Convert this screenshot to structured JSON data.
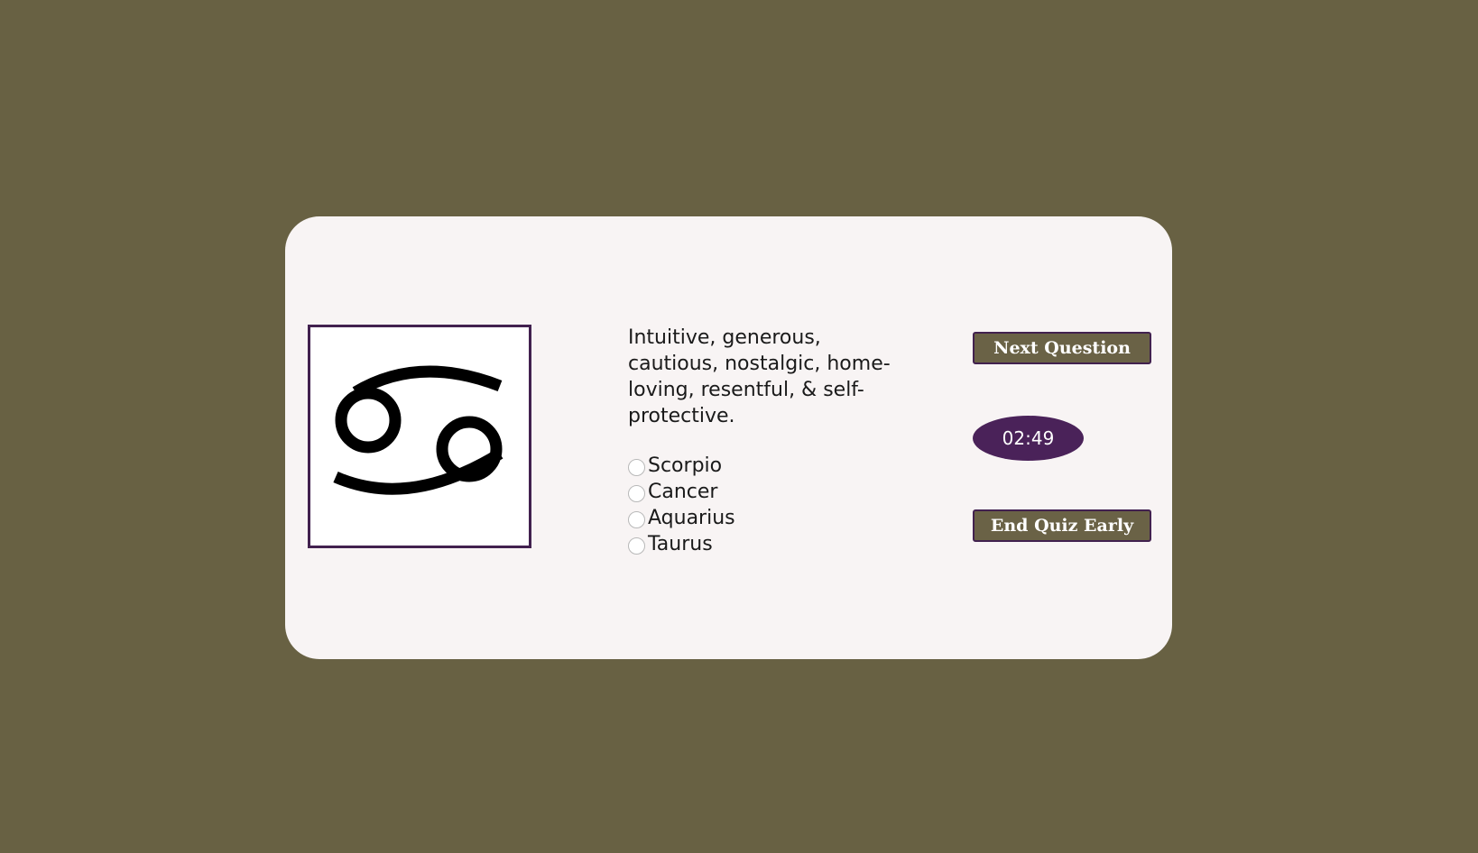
{
  "quiz": {
    "question": "Intuitive, generous, cautious, nostalgic, home-loving, resentful, & self-protective.",
    "options": [
      "Scorpio",
      "Cancer",
      "Aquarius",
      "Taurus"
    ],
    "selected_option": null,
    "sign_icon": "cancer-zodiac-symbol"
  },
  "controls": {
    "next_label": "Next Question",
    "end_label": "End Quiz Early",
    "timer": "02:49"
  },
  "colors": {
    "page_background": "#686143",
    "card_background": "#f8f4f4",
    "button_background": "#6a6246",
    "accent_purple": "#4a2259"
  }
}
